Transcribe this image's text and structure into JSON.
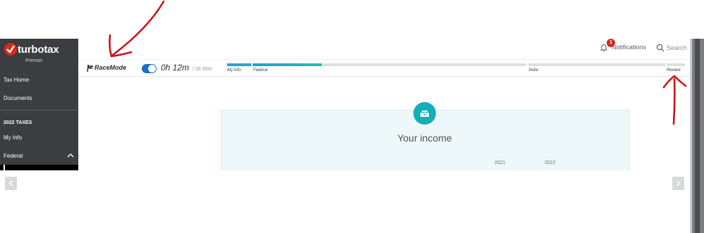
{
  "sidebar": {
    "logo": {
      "name": "turbotax",
      "edition": "Premier"
    },
    "items": [
      {
        "label": "Tax Home"
      },
      {
        "label": "Documents"
      }
    ],
    "section_title": "2022 TAXES",
    "tax_items": [
      {
        "label": "My Info"
      },
      {
        "label": "Federal"
      }
    ]
  },
  "header": {
    "notifications_label": "Notifications",
    "notifications_count": "1",
    "search_label": "Search"
  },
  "race": {
    "title": "RaceMode",
    "toggle_on": true,
    "elapsed": "0h 12m",
    "estimate": "/ 1h 55m",
    "steps": [
      {
        "label": "My Info"
      },
      {
        "label": "Federal"
      },
      {
        "label": "State"
      },
      {
        "label": "Review"
      }
    ]
  },
  "main": {
    "title": "Your income",
    "year_columns": [
      "2021",
      "2022"
    ]
  },
  "colors": {
    "sidebar_bg": "#3b3d40",
    "brand_red": "#d52b1e",
    "accent_teal": "#14aeb9",
    "progress_blue": "#2ca1db",
    "annotation_red": "#c8161a"
  },
  "icons": {
    "notifications": "bell-icon",
    "search": "search-icon",
    "race_flag": "race-flag-icon",
    "income": "cash-drawer-icon",
    "prev": "chevron-left-icon",
    "next": "chevron-right-icon"
  }
}
